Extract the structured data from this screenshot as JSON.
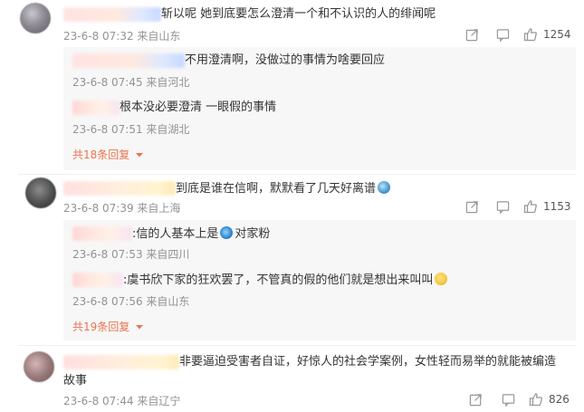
{
  "comments": [
    {
      "text": "斩以呢 她到底要怎么澄清一个和不认识的人的绯闻呢",
      "meta": "23-6-8 07:32 来自山东",
      "likes": "1254",
      "replies": [
        {
          "text": "不用澄清啊，没做过的事情为啥要回应",
          "meta": "23-6-8 07:45 来自河北"
        },
        {
          "text": "根本没必要澄清 一眼假的事情",
          "meta": "23-6-8 07:51 来自湖北"
        }
      ],
      "more_label": "共18条回复"
    },
    {
      "text": "到底是谁在信啊，默默看了几天好离谱",
      "emoji": "shark-emoji",
      "meta": "23-6-8 07:39 来自上海",
      "likes": "1153",
      "replies": [
        {
          "text_before": ":信的人基本上是",
          "emoji": "fish-emoji",
          "text_after": "对家粉",
          "meta": "23-6-8 07:53 来自四川"
        },
        {
          "text": ":虞书欣下家的狂欢罢了，不管真的假的他们就是想出来叫叫",
          "emoji": "sweat-smile-emoji",
          "meta": "23-6-8 07:56 来自山东"
        }
      ],
      "more_label": "共19条回复"
    },
    {
      "text_line1": "非要逼迫受害者自证，好惊人的社会学案例，女性轻而易举的就能被编造",
      "text_line2": "故事",
      "meta": "23-6-8 07:44 来自辽宁",
      "likes": "826"
    }
  ],
  "icons": {
    "share": "share-icon",
    "comment": "comment-icon",
    "like": "thumbs-up-icon",
    "more_chevron": "chevron-down-icon"
  },
  "colors": {
    "accent": "#eb7350",
    "meta": "#939393",
    "reply_bg": "#f7f7f7"
  }
}
